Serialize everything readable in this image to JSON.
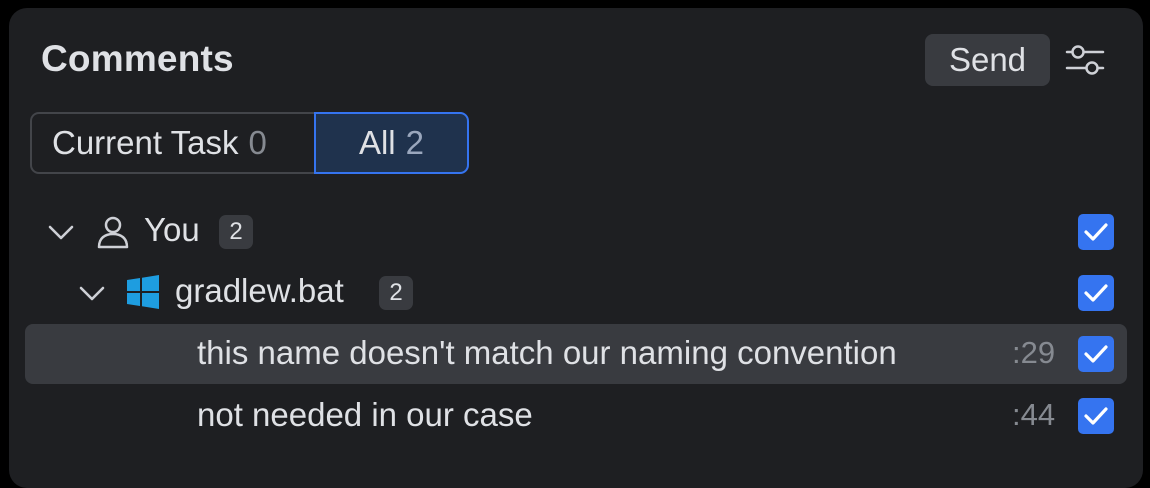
{
  "header": {
    "title": "Comments",
    "send_label": "Send"
  },
  "tabs": [
    {
      "label": "Current Task",
      "count": "0",
      "selected": false
    },
    {
      "label": "All",
      "count": "2",
      "selected": true
    }
  ],
  "tree": {
    "author": {
      "label": "You",
      "count": "2",
      "checked": true,
      "expanded": true
    },
    "file": {
      "label": "gradlew.bat",
      "count": "2",
      "checked": true,
      "expanded": true
    },
    "comments": [
      {
        "text": "this name doesn't match our naming convention",
        "line": ":29",
        "checked": true,
        "selected": true
      },
      {
        "text": "not needed in our case",
        "line": ":44",
        "checked": true,
        "selected": false
      }
    ]
  },
  "colors": {
    "accent": "#3574f0",
    "panel": "#1e1f22",
    "selection": "#393b40",
    "windows_icon": "#1e9de0"
  },
  "icons": {
    "filter": "sliders-icon",
    "author": "person-icon",
    "file": "windows-icon",
    "expand": "chevron-down-icon",
    "check": "checkmark-icon"
  }
}
